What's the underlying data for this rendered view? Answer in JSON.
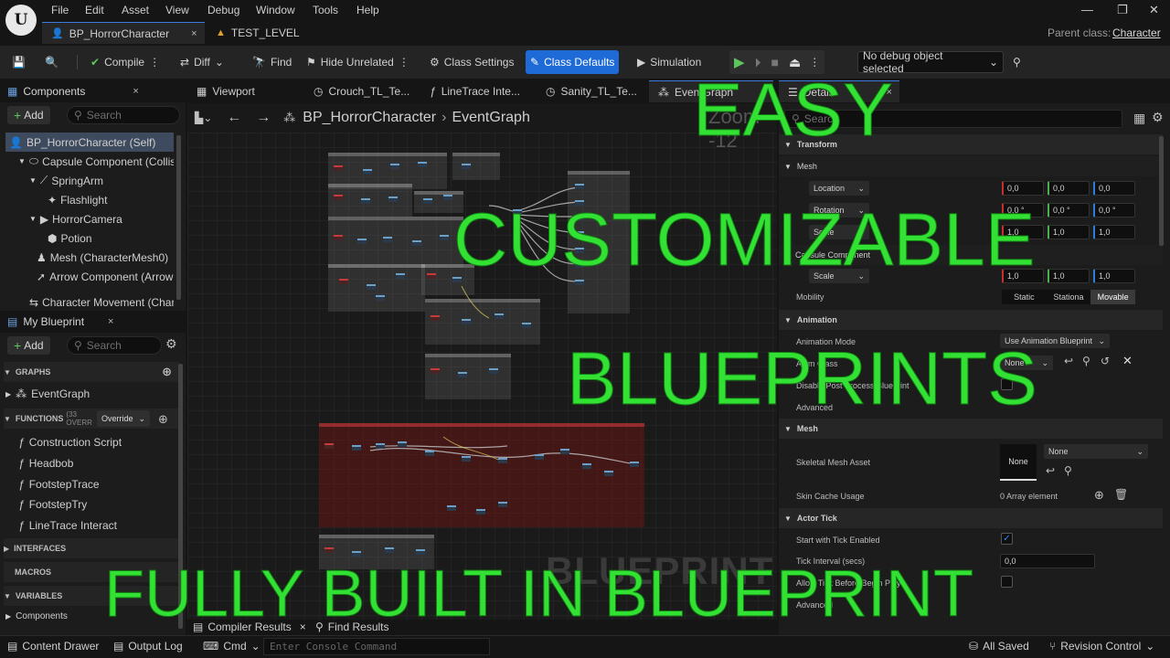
{
  "menu": {
    "logo": "U",
    "items": [
      "File",
      "Edit",
      "Asset",
      "View",
      "Debug",
      "Window",
      "Tools",
      "Help"
    ]
  },
  "doc_tabs": [
    {
      "label": "BP_HorrorCharacter",
      "close": "×"
    },
    {
      "label": "TEST_LEVEL"
    }
  ],
  "parent_class": {
    "label": "Parent class:",
    "value": "Character"
  },
  "toolbar": {
    "compile": "Compile",
    "diff": "Diff",
    "find": "Find",
    "hide_unrelated": "Hide Unrelated",
    "class_settings": "Class Settings",
    "class_defaults": "Class Defaults",
    "simulation": "Simulation",
    "debug_object": "No debug object selected"
  },
  "components": {
    "tab": "Components",
    "add": "Add",
    "search_placeholder": "Search",
    "items": [
      "BP_HorrorCharacter (Self)",
      "Capsule Component (Collis",
      "SpringArm",
      "Flashlight",
      "HorrorCamera",
      "Potion",
      "Mesh (CharacterMesh0)",
      "Arrow Component (Arrow",
      "Character Movement (Char"
    ]
  },
  "my_blueprint": {
    "tab": "My Blueprint",
    "add": "Add",
    "search_placeholder": "Search",
    "graphs": "GRAPHS",
    "event_graph": "EventGraph",
    "functions": "FUNCTIONS",
    "functions_count": "(33 OVERR",
    "override": "Override",
    "function_items": [
      "Construction Script",
      "Headbob",
      "FootstepTrace",
      "FootstepTry",
      "LineTrace Interact"
    ],
    "interfaces": "INTERFACES",
    "macros": "MACROS",
    "variables": "VARIABLES",
    "components": "Components"
  },
  "editor_tabs": [
    "Viewport",
    "Crouch_TL_Te...",
    "LineTrace Inte...",
    "Sanity_TL_Te...",
    "EventGraph"
  ],
  "breadcrumb": {
    "root": "BP_HorrorCharacter",
    "sep": "›",
    "leaf": "EventGraph"
  },
  "zoom": "Zoom -12",
  "graph_watermark": "BLUEPRINT",
  "details": {
    "tab": "Details",
    "search_placeholder": "Search",
    "transform": "Transform",
    "mesh_sub": "Mesh",
    "location": "Location",
    "rotation": "Rotation",
    "scale": "Scale",
    "loc_vals": [
      "0,0",
      "0,0",
      "0,0"
    ],
    "rot_vals": [
      "0,0 °",
      "0,0 °",
      "0,0 °"
    ],
    "scale_vals": [
      "1,0",
      "1,0",
      "1,0"
    ],
    "capsule_component": "Capsule Component",
    "capsule_scale": "Scale",
    "capsule_scale_vals": [
      "1,0",
      "1,0",
      "1,0"
    ],
    "mobility": "Mobility",
    "mobility_opts": [
      "Static",
      "Stationa",
      "Movable"
    ],
    "animation": "Animation",
    "animation_mode": "Animation Mode",
    "animation_mode_val": "Use Animation Blueprint",
    "anim_class": "Anim Class",
    "anim_class_val": "None",
    "disable_post": "Disable Post Process Blueprint",
    "advanced": "Advanced",
    "mesh": "Mesh",
    "skeletal_mesh_asset": "Skeletal Mesh Asset",
    "none_thumb": "None",
    "none_select": "None",
    "skin_cache": "Skin Cache Usage",
    "skin_cache_val": "0 Array element",
    "actor_tick": "Actor Tick",
    "start_tick": "Start with Tick Enabled",
    "tick_interval": "Tick Interval (secs)",
    "tick_interval_val": "0,0",
    "allow_tick": "Allow Tick Before Begin Play",
    "advanced2": "Advanced"
  },
  "bottom_tabs": {
    "compiler_results": "Compiler Results",
    "find_results": "Find Results"
  },
  "statusbar": {
    "content_drawer": "Content Drawer",
    "output_log": "Output Log",
    "cmd": "Cmd",
    "console_placeholder": "Enter Console Command",
    "all_saved": "All Saved",
    "revision_control": "Revision Control"
  },
  "overlay": {
    "easy": "EASY",
    "customizable": "CUSTOMIZABLE",
    "blueprints": "BLUEPRINTS",
    "fully_built": "FULLY BUILT IN BLUEPRINT"
  },
  "colors": {
    "accent": "#1e6ad6",
    "overlay_green": "#33e034"
  }
}
